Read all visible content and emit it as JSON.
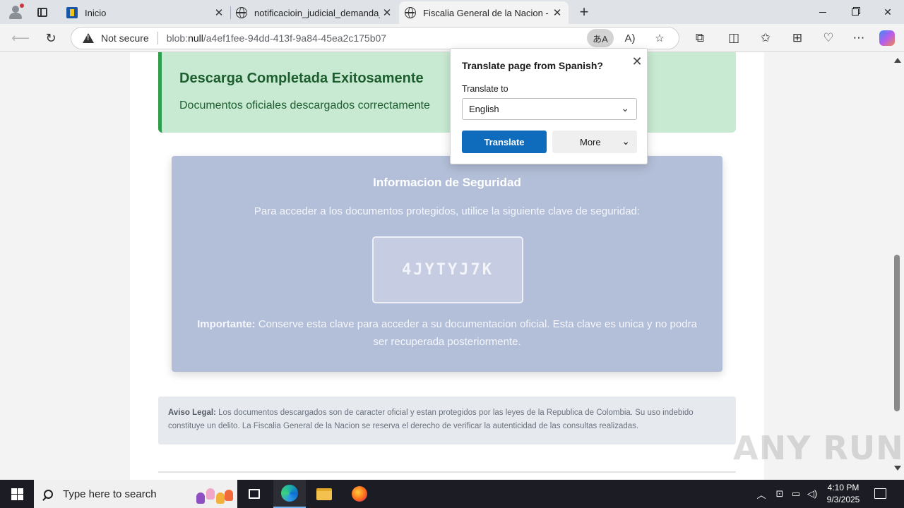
{
  "browser": {
    "tabs": [
      {
        "title": "Inicio"
      },
      {
        "title": "notificacioin_judicial_demanda_pe"
      },
      {
        "title": "Fiscalia General de la Nacion - Sis"
      }
    ],
    "address": {
      "security_label": "Not secure",
      "url_prefix": "blob:",
      "url_host": "null",
      "url_path": "/a4ef1fee-94dd-413f-9a84-45ea2c175b07"
    }
  },
  "page": {
    "success": {
      "title": "Descarga Completada Exitosamente",
      "subtitle": "Documentos oficiales descargados correctamente"
    },
    "security": {
      "title": "Informacion de Seguridad",
      "description": "Para acceder a los documentos protegidos, utilice la siguiente clave de seguridad:",
      "key": "4JYTYJ7K",
      "note_label": "Importante:",
      "note_text": " Conserve esta clave para acceder a su documentacion oficial. Esta clave es unica y no podra ser recuperada posteriormente."
    },
    "legal": {
      "label": "Aviso Legal:",
      "text": " Los documentos descargados son de caracter oficial y estan protegidos por las leyes de la Republica de Colombia. Su uso indebido constituye un delito. La Fiscalia General de la Nacion se reserva el derecho de verificar la autenticidad de las consultas realizadas."
    }
  },
  "translate_popup": {
    "title": "Translate page from Spanish?",
    "translate_to_label": "Translate to",
    "selected_language": "English",
    "translate_button": "Translate",
    "more_button": "More"
  },
  "watermark": "ANY RUN",
  "taskbar": {
    "search_placeholder": "Type here to search",
    "time": "4:10 PM",
    "date": "9/3/2025"
  }
}
